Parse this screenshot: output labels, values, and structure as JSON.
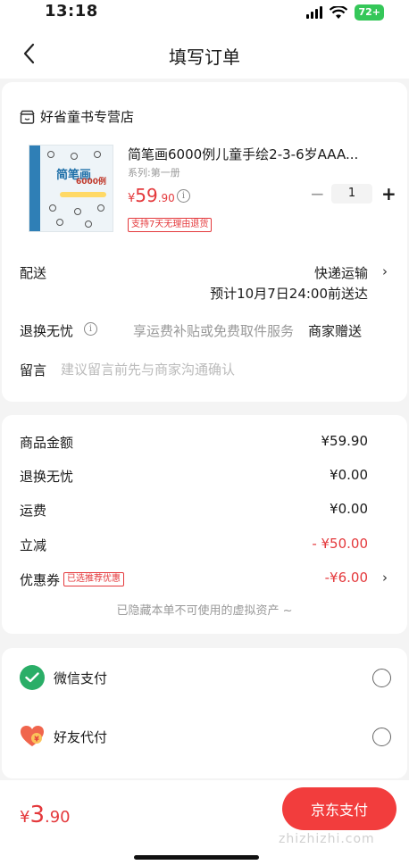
{
  "status": {
    "time": "13:18",
    "battery": "72+"
  },
  "nav": {
    "title": "填写订单"
  },
  "store": {
    "name": "好省童书专营店"
  },
  "product": {
    "title": "简笔画6000例儿童手绘2-3-6岁AAA...",
    "series": "系列:第一册",
    "price_currency": "¥",
    "price_int": "59",
    "price_dec": ".90",
    "tag": "支持7天无理由退货",
    "quantity": "1",
    "thumb_title": "简笔画",
    "thumb_sub": "6000例"
  },
  "shipping": {
    "label": "配送",
    "method": "快递运输",
    "eta": "预计10月7日24:00前送达"
  },
  "returns": {
    "label": "退换无忧",
    "desc": "享运费补贴或免费取件服务",
    "gift": "商家赠送"
  },
  "note": {
    "label": "留言",
    "placeholder": "建议留言前先与商家沟通确认"
  },
  "prices": [
    {
      "label": "商品金额",
      "value": "¥59.90"
    },
    {
      "label": "退换无忧",
      "value": "¥0.00"
    },
    {
      "label": "运费",
      "value": "¥0.00"
    },
    {
      "label": "立减",
      "value": "- ¥50.00"
    },
    {
      "label": "优惠券",
      "value": "-¥6.00",
      "tag": "已选推荐优惠"
    }
  ],
  "hidden_assets": "已隐藏本单不可使用的虚拟资产 ~",
  "payments": [
    {
      "label": "微信支付",
      "icon": "wechat-pay-icon"
    },
    {
      "label": "好友代付",
      "icon": "friend-pay-icon"
    }
  ],
  "footer": {
    "total_currency": "¥",
    "total_int": "3",
    "total_dec": ".90",
    "pay_button": "京东支付",
    "watermark": "zhizhizhi.com"
  },
  "colors": {
    "accent": "#e4393c",
    "wechat": "#2aae67",
    "battery": "#35c759"
  }
}
